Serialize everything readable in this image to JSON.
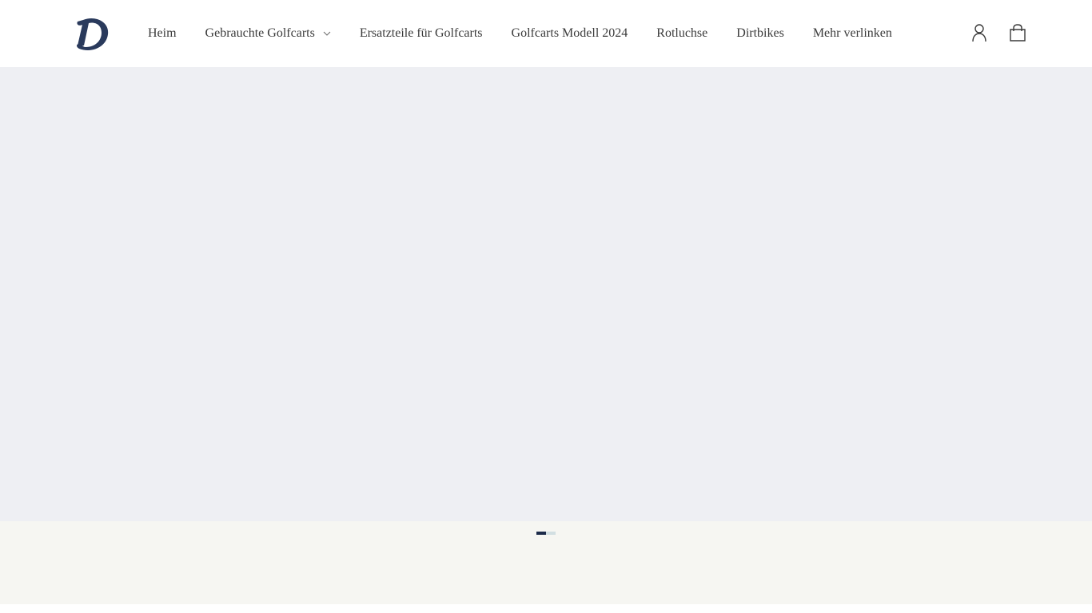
{
  "header": {
    "logo_letter": "D",
    "nav": [
      {
        "label": "Heim",
        "has_dropdown": false
      },
      {
        "label": "Gebrauchte Golfcarts",
        "has_dropdown": true
      },
      {
        "label": "Ersatzteile für Golfcarts",
        "has_dropdown": false
      },
      {
        "label": "Golfcarts Modell 2024",
        "has_dropdown": false
      },
      {
        "label": "Rotluchse",
        "has_dropdown": false
      },
      {
        "label": "Dirtbikes",
        "has_dropdown": false
      },
      {
        "label": "Mehr verlinken",
        "has_dropdown": false
      }
    ],
    "icons": [
      "account-icon",
      "cart-icon"
    ]
  },
  "hero": {
    "slide_count": 2,
    "active_slide": 1
  },
  "colors": {
    "header_bg": "#ffffff",
    "hero_bg": "#eeeff3",
    "page_bg": "#f6f6f2",
    "brand_navy": "#1c2b4a",
    "dot_inactive": "#d2dfe2",
    "nav_text": "#3a3a3a"
  }
}
